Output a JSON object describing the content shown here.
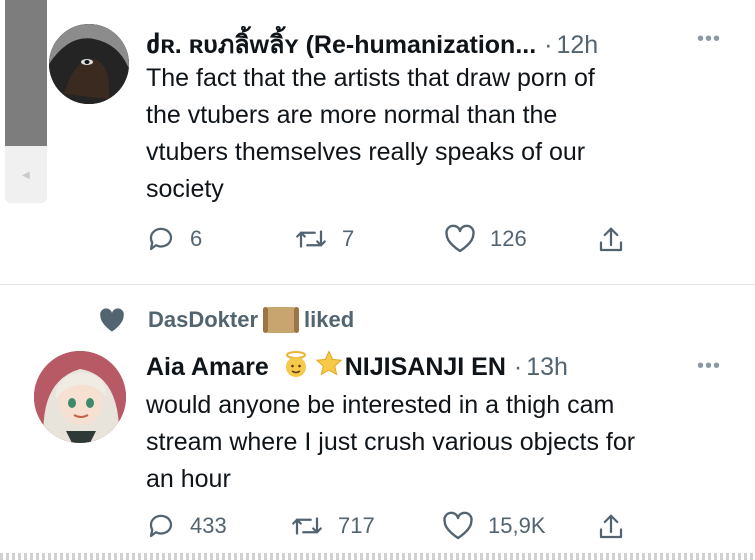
{
  "tweets": [
    {
      "author": "ძʀ. ʀυภลิ้wลิ้ʏ (Re-humanization...",
      "time": "12h",
      "more": "•••",
      "text_lines": [
        "The fact that the artists that draw porn of",
        "the vtubers are more normal than the",
        "vtubers themselves really speaks of our",
        "society"
      ],
      "replies": "6",
      "retweets": "7",
      "likes": "126"
    },
    {
      "liked_by": "DasDokter",
      "liked_label": "liked",
      "author": "Aia Amare",
      "author_suffix": "NIJISANJI EN",
      "time": "13h",
      "more": "•••",
      "text_lines": [
        "would anyone be interested in a thigh cam",
        "stream where I just crush various objects for",
        "an hour"
      ],
      "replies": "433",
      "retweets": "717",
      "likes": "15,9K"
    }
  ],
  "colors": {
    "text": "#0f1419",
    "muted": "#536471",
    "divider": "#e1e4e6"
  }
}
